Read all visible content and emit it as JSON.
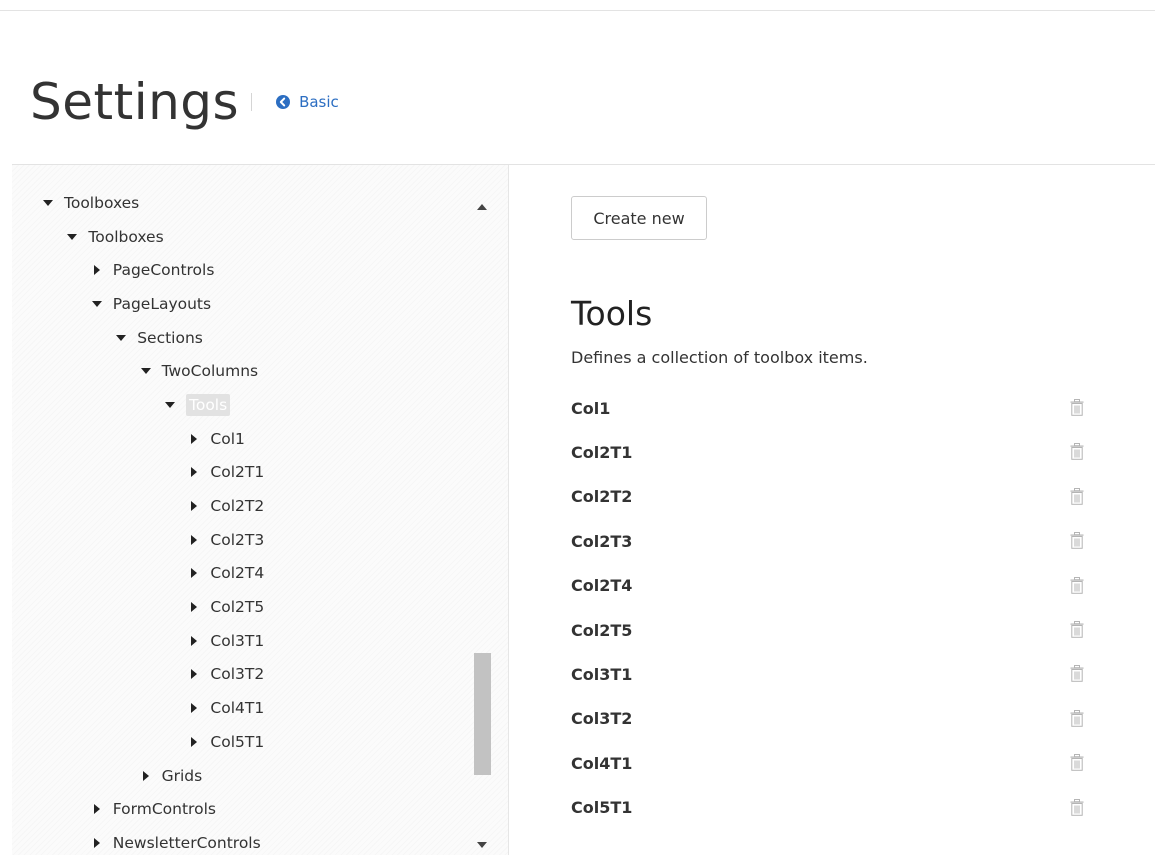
{
  "header": {
    "title": "Settings",
    "basic_link_label": "Basic",
    "basic_icon": "circle-arrow-left-icon"
  },
  "tree": {
    "nodes": [
      {
        "label": "Toolboxes",
        "level": 0,
        "expanded": true
      },
      {
        "label": "Toolboxes",
        "level": 1,
        "expanded": true
      },
      {
        "label": "PageControls",
        "level": 2,
        "expanded": false
      },
      {
        "label": "PageLayouts",
        "level": 2,
        "expanded": true
      },
      {
        "label": "Sections",
        "level": 3,
        "expanded": true
      },
      {
        "label": "TwoColumns",
        "level": 4,
        "expanded": true
      },
      {
        "label": "Tools",
        "level": 5,
        "expanded": true,
        "selected": true
      },
      {
        "label": "Col1",
        "level": 6,
        "expanded": false
      },
      {
        "label": "Col2T1",
        "level": 6,
        "expanded": false
      },
      {
        "label": "Col2T2",
        "level": 6,
        "expanded": false
      },
      {
        "label": "Col2T3",
        "level": 6,
        "expanded": false
      },
      {
        "label": "Col2T4",
        "level": 6,
        "expanded": false
      },
      {
        "label": "Col2T5",
        "level": 6,
        "expanded": false
      },
      {
        "label": "Col3T1",
        "level": 6,
        "expanded": false
      },
      {
        "label": "Col3T2",
        "level": 6,
        "expanded": false
      },
      {
        "label": "Col4T1",
        "level": 6,
        "expanded": false
      },
      {
        "label": "Col5T1",
        "level": 6,
        "expanded": false
      },
      {
        "label": "Grids",
        "level": 4,
        "expanded": false
      },
      {
        "label": "FormControls",
        "level": 2,
        "expanded": false
      },
      {
        "label": "NewsletterControls",
        "level": 2,
        "expanded": false
      }
    ]
  },
  "main": {
    "create_button_label": "Create new",
    "section_title": "Tools",
    "section_description": "Defines a collection of toolbox items.",
    "items": [
      "Col1",
      "Col2T1",
      "Col2T2",
      "Col2T3",
      "Col2T4",
      "Col2T5",
      "Col3T1",
      "Col3T2",
      "Col4T1",
      "Col5T1"
    ],
    "delete_icon": "trash-icon"
  },
  "colors": {
    "link": "#2c6ec2",
    "selected_node_bg": "#e2e2e2",
    "icon_gray": "#b5b5b5"
  }
}
